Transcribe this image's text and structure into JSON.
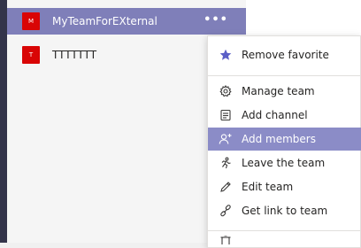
{
  "teams": [
    {
      "avatar_letter": "M",
      "name": "MyTeamForEXternal",
      "more_label": "•••"
    },
    {
      "avatar_letter": "T",
      "name": "TTTTTTT"
    }
  ],
  "menu": {
    "items": [
      {
        "label": "Remove favorite",
        "icon": "star-icon"
      },
      {
        "label": "Manage team",
        "icon": "gear-icon"
      },
      {
        "label": "Add channel",
        "icon": "add-channel-icon"
      },
      {
        "label": "Add members",
        "icon": "add-person-icon",
        "highlighted": true
      },
      {
        "label": "Leave the team",
        "icon": "leave-icon"
      },
      {
        "label": "Edit team",
        "icon": "pencil-icon"
      },
      {
        "label": "Get link to team",
        "icon": "link-icon"
      }
    ]
  },
  "colors": {
    "selected_row": "#7f7fb9",
    "menu_highlight": "#8b8cc7",
    "avatar": "#d90505",
    "rail": "#33344a"
  }
}
